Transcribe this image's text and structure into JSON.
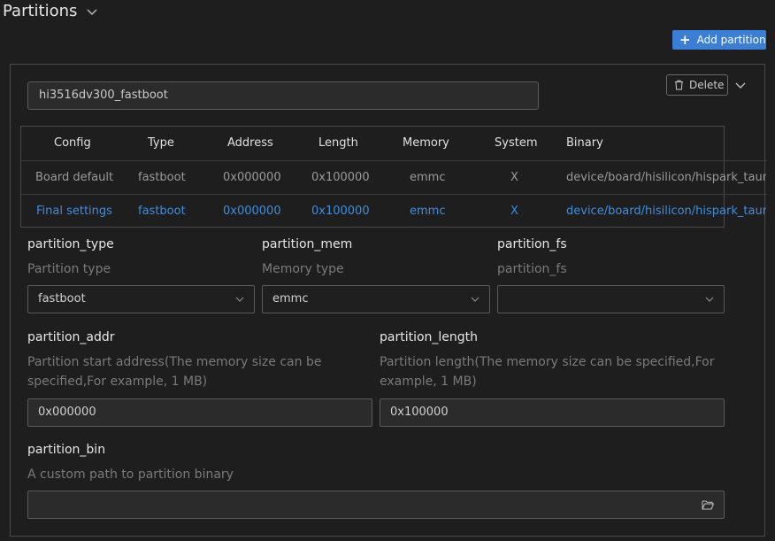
{
  "header": {
    "title": "Partitions"
  },
  "toolbar": {
    "add_label": "Add partition"
  },
  "partition": {
    "name_value": "hi3516dv300_fastboot",
    "delete_label": "Delete"
  },
  "table": {
    "columns": [
      "Config",
      "Type",
      "Address",
      "Length",
      "Memory",
      "System",
      "Binary"
    ],
    "rows": [
      {
        "config": "Board default",
        "type": "fastboot",
        "address": "0x000000",
        "length": "0x100000",
        "memory": "emmc",
        "system": "X",
        "binary": "device/board/hisilicon/hispark_tauru"
      },
      {
        "config": "Final settings",
        "type": "fastboot",
        "address": "0x000000",
        "length": "0x100000",
        "memory": "emmc",
        "system": "X",
        "binary": "device/board/hisilicon/hispark_tauru"
      }
    ]
  },
  "fields": {
    "partition_type": {
      "label": "partition_type",
      "desc": "Partition type",
      "value": "fastboot"
    },
    "partition_mem": {
      "label": "partition_mem",
      "desc": "Memory type",
      "value": "emmc"
    },
    "partition_fs": {
      "label": "partition_fs",
      "desc": "partition_fs",
      "value": ""
    },
    "partition_addr": {
      "label": "partition_addr",
      "desc_line1": "Partition start address(The memory size can be",
      "desc_line2": "specified,For example, 1 MB)",
      "value": "0x000000"
    },
    "partition_length": {
      "label": "partition_length",
      "desc_line1": "Partition length(The memory size can be specified,For",
      "desc_line2": "example, 1 MB)",
      "value": "0x100000"
    },
    "partition_bin": {
      "label": "partition_bin",
      "desc": "A custom path to partition binary",
      "value": ""
    }
  },
  "icons": {
    "header_chevron": "chevron-down-icon",
    "add": "plus-icon",
    "delete": "trash-icon",
    "panel_chevron": "chevron-down-icon",
    "select_chevron": "chevron-down-icon",
    "folder": "folder-open-icon"
  },
  "colors": {
    "accent": "#3b7ed6",
    "final_row": "#3e8ee0"
  }
}
